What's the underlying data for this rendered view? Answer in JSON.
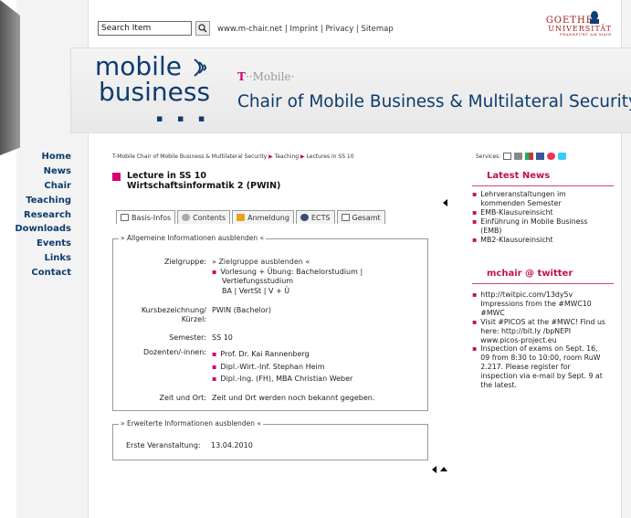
{
  "search": {
    "value": "Search Item"
  },
  "top_links": [
    "www.m-chair.net",
    "Imprint",
    "Privacy",
    "Sitemap"
  ],
  "goethe": {
    "line1": "GOETHE",
    "line2": "UNIVERSITÄT",
    "line3": "FRANKFURT AM MAIN"
  },
  "banner": {
    "logo_line1": "mobile",
    "logo_line2": "business",
    "logo_dots": "▪ ▪ ▪",
    "tmobile_t": "T",
    "tmobile_rest": "··Mobile·",
    "chair_title": "Chair of Mobile Business & Multilateral Security"
  },
  "sidenav": [
    "Home",
    "News",
    "Chair",
    "Teaching",
    "Research",
    "Downloads",
    "Events",
    "Links",
    "Contact"
  ],
  "breadcrumb": [
    "T-Mobile Chair of Mobile Business & Multilateral Security",
    "Teaching",
    "Lectures in SS 10"
  ],
  "services_label": "Services:",
  "page": {
    "title_line1": "Lecture in SS 10",
    "title_line2": "Wirtschaftsinformatik 2 (PWIN)"
  },
  "tabs": [
    "Basis-Infos",
    "Contents",
    "Anmeldung",
    "ECTS",
    "Gesamt"
  ],
  "general": {
    "legend": "» Allgemeine Informationen ausblenden «",
    "zielgruppe_label": "Zielgruppe:",
    "zielgruppe_toggle": "» Zielgruppe ausblenden «",
    "zielgruppe_l1": "Vorlesung + Übung: Bachelorstudium |",
    "zielgruppe_l2": "Vertiefungsstudium",
    "zielgruppe_l3": "BA | VertSt | V + Ü",
    "kurs_label_1": "Kursbezeichnung/",
    "kurs_label_2": "Kürzel:",
    "kurs_value": "PWIN (Bachelor)",
    "semester_label": "Semester:",
    "semester_value": "SS 10",
    "dozenten_label": "Dozenten/-innen:",
    "dozenten": [
      "Prof. Dr. Kai Rannenberg",
      "Dipl.-Wirt.-Inf. Stephan Heim",
      "Dipl.-Ing. (FH), MBA Christian Weber"
    ],
    "zeit_label": "Zeit und Ort:",
    "zeit_value": "Zeit und Ort werden noch bekannt gegeben."
  },
  "extended": {
    "legend": "» Erweiterte Informationen ausblenden «",
    "label": "Erste Veranstaltung:",
    "value": "13.04.2010"
  },
  "latest_news": {
    "title": "Latest News",
    "items": [
      "Lehrveranstaltungen im kommenden Semester",
      "EMB-Klausureinsicht",
      "Einführung in Mobile Business (EMB)",
      "MB2-Klausureinsicht"
    ]
  },
  "twitter": {
    "title": "mchair @ twitter",
    "items": [
      "http://twitpic.com/13dy5v Impressions from the #MWC10 #MWC",
      "Visit #PICOS at the #MWC! Find us here: http://bit.ly /bpNEPI www.picos-project.eu",
      "Inspection of exams on Sept. 16, 09 from 8:30 to 10:00, room RuW 2.217. Please register for inspection via e-mail by Sept. 9 at the latest."
    ]
  }
}
